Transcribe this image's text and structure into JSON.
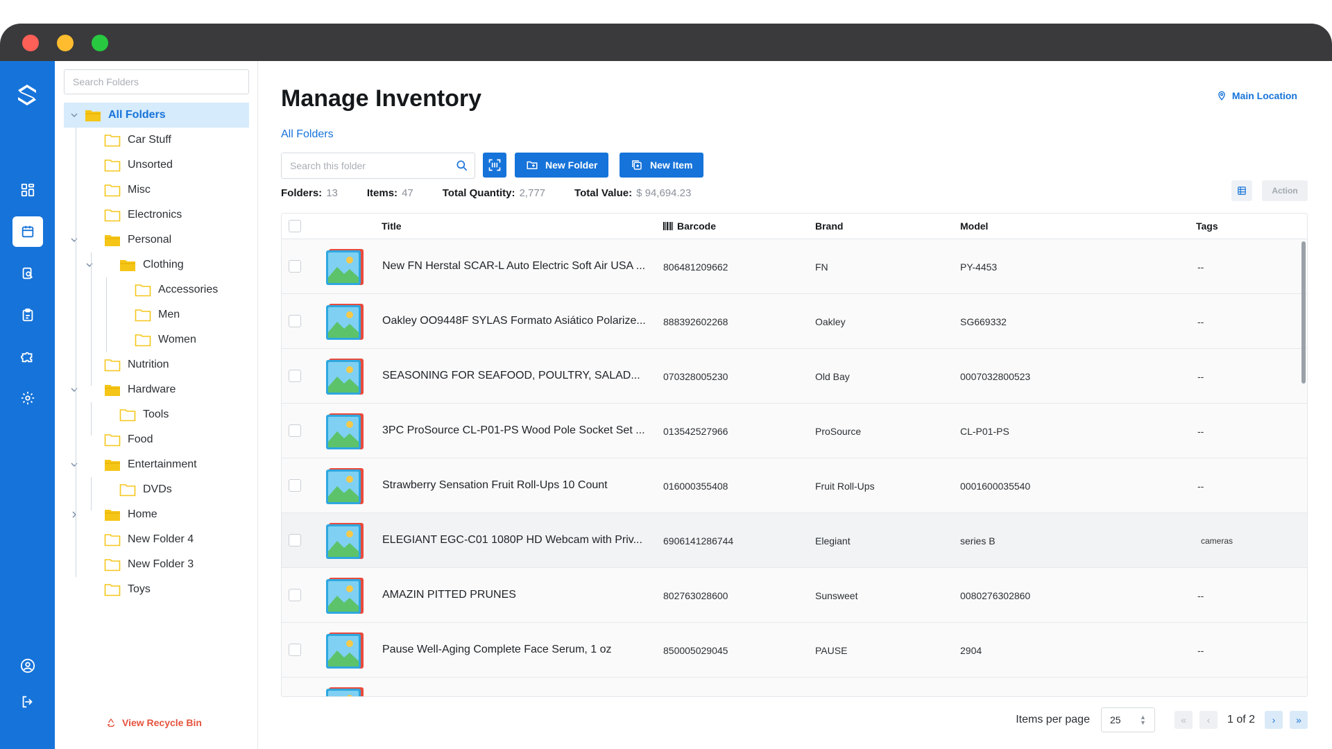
{
  "window": {
    "controls": [
      "close",
      "minimize",
      "maximize"
    ]
  },
  "colors": {
    "accent": "#1673d9",
    "folder": "#f5c518",
    "recycle": "#e5533d"
  },
  "rail": {
    "items": [
      {
        "icon": "dashboard-icon",
        "active": false
      },
      {
        "icon": "inventory-icon",
        "active": true
      },
      {
        "icon": "search-clipboard-icon",
        "active": false
      },
      {
        "icon": "clipboard-icon",
        "active": false
      },
      {
        "icon": "puzzle-icon",
        "active": false
      },
      {
        "icon": "gear-icon",
        "active": false
      }
    ],
    "bottom": [
      {
        "icon": "user-circle-icon"
      },
      {
        "icon": "logout-icon"
      }
    ]
  },
  "folders": {
    "search_placeholder": "Search Folders",
    "tree": [
      {
        "label": "All Folders",
        "level": 0,
        "open": true,
        "selected": true,
        "chevron": "down"
      },
      {
        "label": "Car Stuff",
        "level": 1
      },
      {
        "label": "Unsorted",
        "level": 1
      },
      {
        "label": "Misc",
        "level": 1
      },
      {
        "label": "Electronics",
        "level": 1
      },
      {
        "label": "Personal",
        "level": 1,
        "open": true,
        "chevron": "down"
      },
      {
        "label": "Clothing",
        "level": 2,
        "open": true,
        "chevron": "down"
      },
      {
        "label": "Accessories",
        "level": 3
      },
      {
        "label": "Men",
        "level": 3
      },
      {
        "label": "Women",
        "level": 3
      },
      {
        "label": "Nutrition",
        "level": 1
      },
      {
        "label": "Hardware",
        "level": 1,
        "open": true,
        "chevron": "down"
      },
      {
        "label": "Tools",
        "level": 2
      },
      {
        "label": "Food",
        "level": 1
      },
      {
        "label": "Entertainment",
        "level": 1,
        "open": true,
        "chevron": "down"
      },
      {
        "label": "DVDs",
        "level": 2
      },
      {
        "label": "Home",
        "level": 1,
        "filled": true,
        "chevron": "right"
      },
      {
        "label": "New Folder 4",
        "level": 1
      },
      {
        "label": "New Folder 3",
        "level": 1
      },
      {
        "label": "Toys",
        "level": 1
      }
    ],
    "recycle_label": "View Recycle Bin"
  },
  "main": {
    "title": "Manage Inventory",
    "location": "Main Location",
    "breadcrumb": "All Folders",
    "search_placeholder": "Search this folder",
    "new_folder": "New Folder",
    "new_item": "New Item",
    "action": "Action",
    "stats": {
      "folders_label": "Folders:",
      "folders": "13",
      "items_label": "Items:",
      "items": "47",
      "qty_label": "Total Quantity:",
      "qty": "2,777",
      "value_label": "Total Value:",
      "value": "$ 94,694.23"
    }
  },
  "table": {
    "columns": {
      "title": "Title",
      "barcode": "Barcode",
      "brand": "Brand",
      "model": "Model",
      "tags": "Tags"
    },
    "rows": [
      {
        "title": "New FN Herstal SCAR-L Auto Electric Soft Air USA ...",
        "barcode": "806481209662",
        "brand": "FN",
        "model": "PY-4453",
        "tags": "--"
      },
      {
        "title": "Oakley OO9448F SYLAS Formato Asiático Polarize...",
        "barcode": "888392602268",
        "brand": "Oakley",
        "model": "SG669332",
        "tags": "--"
      },
      {
        "title": "SEASONING FOR SEAFOOD, POULTRY, SALAD...",
        "barcode": "070328005230",
        "brand": "Old Bay",
        "model": "0007032800523",
        "tags": "--"
      },
      {
        "title": "3PC ProSource CL-P01-PS Wood Pole Socket Set ...",
        "barcode": "013542527966",
        "brand": "ProSource",
        "model": "CL-P01-PS",
        "tags": "--"
      },
      {
        "title": "Strawberry Sensation Fruit Roll-Ups 10 Count",
        "barcode": "016000355408",
        "brand": "Fruit Roll-Ups",
        "model": "0001600035540",
        "tags": "--"
      },
      {
        "title": "ELEGIANT EGC-C01 1080P HD Webcam with Priv...",
        "barcode": "6906141286744",
        "brand": "Elegiant",
        "model": "series B",
        "tags": "cameras",
        "highlight": true
      },
      {
        "title": "AMAZIN PITTED PRUNES",
        "barcode": "802763028600",
        "brand": "Sunsweet",
        "model": "0080276302860",
        "tags": "--"
      },
      {
        "title": "Pause Well-Aging Complete Face Serum, 1 oz",
        "barcode": "850005029045",
        "brand": "PAUSE",
        "model": "2904",
        "tags": "--"
      }
    ]
  },
  "pager": {
    "ipp_label": "Items per page",
    "ipp_value": "25",
    "info": "1 of 2"
  }
}
